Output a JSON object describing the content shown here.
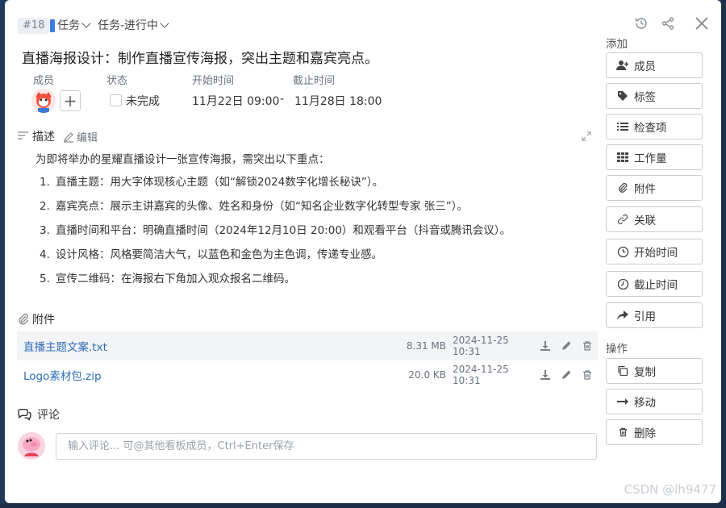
{
  "header": {
    "task_id": "#18",
    "type_label": "任务",
    "status_label": "任务-进行中"
  },
  "title": "直播海报设计：制作直播宣传海报，突出主题和嘉宾亮点。",
  "fields": {
    "member_label": "成员",
    "status_label": "状态",
    "start_label": "开始时间",
    "end_label": "截止时间",
    "status_value": "未完成",
    "start_value": "11月22日 09:00",
    "date_sep": "-",
    "end_value": "11月28日 18:00"
  },
  "description": {
    "title": "描述",
    "edit_label": "编辑",
    "intro": "为即将举办的星耀直播设计一张宣传海报，需突出以下重点：",
    "items": [
      {
        "num": "1.",
        "text": "直播主题：用大字体现核心主题（如“解锁2024数字化增长秘诀”）。"
      },
      {
        "num": "2.",
        "text": "嘉宾亮点：展示主讲嘉宾的头像、姓名和身份（如“知名企业数字化转型专家 张三”）。"
      },
      {
        "num": "3.",
        "text": "直播时间和平台：明确直播时间（2024年12月10日 20:00）和观看平台（抖音或腾讯会议）。"
      },
      {
        "num": "4.",
        "text": "设计风格：风格要简洁大气，以蓝色和金色为主色调，传递专业感。"
      },
      {
        "num": "5.",
        "text": "宣传二维码：在海报右下角加入观众报名二维码。"
      }
    ]
  },
  "attachments": {
    "title": "附件",
    "files": [
      {
        "name": "直播主题文案.txt",
        "size": "8.31 MB",
        "date": "2024-11-25 10:31"
      },
      {
        "name": "Logo素材包.zip",
        "size": "20.0 KB",
        "date": "2024-11-25 10:31"
      }
    ]
  },
  "comments": {
    "title": "评论",
    "placeholder": "输入评论... 可@其他看板成员，Ctrl+Enter保存"
  },
  "sidebar": {
    "add_label": "添加",
    "add_buttons": [
      "成员",
      "标签",
      "检查项",
      "工作量",
      "附件",
      "关联",
      "开始时间",
      "截止时间",
      "引用"
    ],
    "ops_label": "操作",
    "op_buttons": [
      "复制",
      "移动",
      "删除"
    ]
  },
  "watermark": "CSDN @lh9477",
  "colors": {
    "accent": "#3b7ddd",
    "link": "#2e6dba",
    "frame": "#1f3a5a"
  }
}
